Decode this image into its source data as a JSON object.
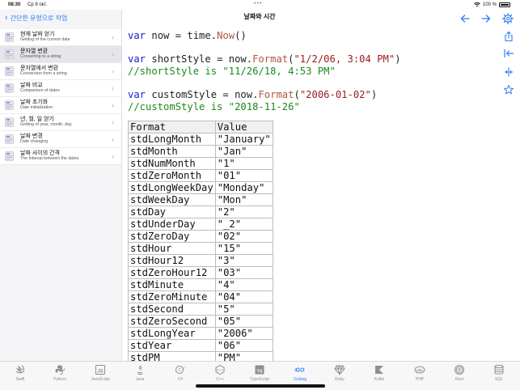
{
  "status_bar": {
    "time": "08:30",
    "date": "Ср 9 окт.",
    "battery": "100 %"
  },
  "sidebar": {
    "back_label": "간단한 유형으로 작업",
    "items": [
      {
        "title": "현재 날짜 얻기",
        "subtitle": "Getting of the current date"
      },
      {
        "title": "문자열 변환",
        "subtitle": "Converting to a string"
      },
      {
        "title": "문자열에서 변환",
        "subtitle": "Conversion from a string"
      },
      {
        "title": "날짜 비교",
        "subtitle": "Comparison of dates"
      },
      {
        "title": "날짜 초기화",
        "subtitle": "Date initialization"
      },
      {
        "title": "년, 월, 일 얻기",
        "subtitle": "Getting of year, month, day"
      },
      {
        "title": "날짜 변경",
        "subtitle": "Date changing"
      },
      {
        "title": "날짜 사이의 간격",
        "subtitle": "The interval between the dates"
      }
    ],
    "selected_index": 1
  },
  "header": {
    "title": "날짜와 시간"
  },
  "code": {
    "l1": {
      "kw": "var",
      "id": " now = time.",
      "fn": "Now",
      "rest": "()"
    },
    "l2": {
      "kw": "var",
      "id": " shortStyle = now.",
      "fn": "Format",
      "open": "(",
      "str": "\"1/2/06, 3:04 PM\"",
      "close": ")"
    },
    "l3": {
      "cmt": "//shortStyle is \"11/26/18, 4:53 PM\""
    },
    "l4": {
      "kw": "var",
      "id": " customStyle = now.",
      "fn": "Format",
      "open": "(",
      "str": "\"2006-01-02\"",
      "close": ")"
    },
    "l5": {
      "cmt": "//customStyle is \"2018-11-26\""
    }
  },
  "table": {
    "headers": [
      "Format",
      "Value"
    ],
    "rows": [
      [
        "stdLongMonth",
        "\"January\""
      ],
      [
        "stdMonth",
        "\"Jan\""
      ],
      [
        "stdNumMonth",
        "\"1\""
      ],
      [
        "stdZeroMonth",
        "\"01\""
      ],
      [
        "stdLongWeekDay",
        "\"Monday\""
      ],
      [
        "stdWeekDay",
        "\"Mon\""
      ],
      [
        "stdDay",
        "\"2\""
      ],
      [
        "stdUnderDay",
        "\"_2\""
      ],
      [
        "stdZeroDay",
        "\"02\""
      ],
      [
        "stdHour",
        "\"15\""
      ],
      [
        "stdHour12",
        "\"3\""
      ],
      [
        "stdZeroHour12",
        "\"03\""
      ],
      [
        "stdMinute",
        "\"4\""
      ],
      [
        "stdZeroMinute",
        "\"04\""
      ],
      [
        "stdSecond",
        "\"5\""
      ],
      [
        "stdZeroSecond",
        "\"05\""
      ],
      [
        "stdLongYear",
        "\"2006\""
      ],
      [
        "stdYear",
        "\"06\""
      ],
      [
        "stdPM",
        "\"PM\""
      ]
    ]
  },
  "tabs": [
    {
      "label": "Swift",
      "icon": "swift-icon"
    },
    {
      "label": "Python",
      "icon": "python-icon"
    },
    {
      "label": "JavaScript",
      "icon": "javascript-icon"
    },
    {
      "label": "Java",
      "icon": "java-icon"
    },
    {
      "label": "C#",
      "icon": "csharp-icon"
    },
    {
      "label": "C++",
      "icon": "cpp-icon"
    },
    {
      "label": "TypeScript",
      "icon": "typescript-icon"
    },
    {
      "label": "Golang",
      "icon": "golang-icon"
    },
    {
      "label": "Ruby",
      "icon": "ruby-icon"
    },
    {
      "label": "Kotlin",
      "icon": "kotlin-icon"
    },
    {
      "label": "PHP",
      "icon": "php-icon"
    },
    {
      "label": "Rust",
      "icon": "rust-icon"
    },
    {
      "label": "SQL",
      "icon": "sql-icon"
    }
  ],
  "active_tab": "Golang",
  "colors": {
    "accent": "#2e7cf6",
    "keyword": "#1a1ad4",
    "function": "#b0553f",
    "string": "#9a1a1a",
    "comment": "#1a8a1a"
  }
}
